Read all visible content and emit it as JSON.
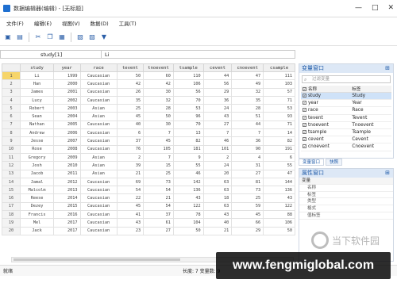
{
  "window": {
    "title": "数据编辑器(编辑) - [无标题]",
    "controls": [
      "—",
      "□",
      "✕"
    ]
  },
  "menu": [
    "文件(F)",
    "编辑(E)",
    "视图(V)",
    "数据(D)",
    "工具(T)"
  ],
  "formula": {
    "cell_ref": "study[1]",
    "value": "Li"
  },
  "grid": {
    "columns": [
      "study",
      "year",
      "race",
      "tevent",
      "tnoevent",
      "tsample",
      "cevent",
      "cnoevent",
      "csample"
    ],
    "rows": [
      [
        "1",
        "Li",
        "1999",
        "Caucasian",
        "50",
        "60",
        "110",
        "44",
        "47",
        "111"
      ],
      [
        "2",
        "Han",
        "2000",
        "Caucasian",
        "42",
        "42",
        "106",
        "56",
        "49",
        "103"
      ],
      [
        "3",
        "James",
        "2001",
        "Caucasian",
        "26",
        "30",
        "56",
        "29",
        "32",
        "57"
      ],
      [
        "4",
        "Lucy",
        "2002",
        "Caucasian",
        "35",
        "32",
        "70",
        "36",
        "35",
        "71"
      ],
      [
        "5",
        "Robert",
        "2003",
        "Asian",
        "25",
        "28",
        "53",
        "24",
        "28",
        "53"
      ],
      [
        "6",
        "Sean",
        "2004",
        "Asian",
        "45",
        "50",
        "96",
        "43",
        "51",
        "93"
      ],
      [
        "7",
        "Nathan",
        "2005",
        "Caucasian",
        "40",
        "30",
        "70",
        "27",
        "44",
        "71"
      ],
      [
        "8",
        "Andrew",
        "2006",
        "Caucasian",
        "6",
        "7",
        "13",
        "7",
        "7",
        "14"
      ],
      [
        "9",
        "Jesse",
        "2007",
        "Caucasian",
        "37",
        "45",
        "82",
        "46",
        "36",
        "82"
      ],
      [
        "10",
        "Rose",
        "2008",
        "Caucasian",
        "76",
        "105",
        "181",
        "101",
        "90",
        "191"
      ],
      [
        "11",
        "Gregory",
        "2009",
        "Asian",
        "2",
        "7",
        "9",
        "2",
        "4",
        "6"
      ],
      [
        "12",
        "Josh",
        "2010",
        "Asian",
        "39",
        "15",
        "55",
        "24",
        "31",
        "55"
      ],
      [
        "13",
        "Jacob",
        "2011",
        "Asian",
        "21",
        "25",
        "46",
        "20",
        "27",
        "47"
      ],
      [
        "14",
        "Jamal",
        "2012",
        "Caucasian",
        "69",
        "73",
        "142",
        "63",
        "81",
        "144"
      ],
      [
        "15",
        "Malcolm",
        "2013",
        "Caucasian",
        "54",
        "54",
        "136",
        "63",
        "73",
        "136"
      ],
      [
        "16",
        "Reese",
        "2014",
        "Caucasian",
        "22",
        "21",
        "43",
        "18",
        "25",
        "43"
      ],
      [
        "17",
        "Dezey",
        "2015",
        "Caucasian",
        "45",
        "54",
        "122",
        "63",
        "59",
        "122"
      ],
      [
        "18",
        "Francis",
        "2016",
        "Caucasian",
        "41",
        "37",
        "78",
        "43",
        "45",
        "88"
      ],
      [
        "19",
        "Mel",
        "2017",
        "Caucasian",
        "43",
        "61",
        "104",
        "40",
        "66",
        "106"
      ],
      [
        "20",
        "Jack",
        "2017",
        "Caucasian",
        "23",
        "27",
        "50",
        "21",
        "29",
        "50"
      ]
    ]
  },
  "variable_panel": {
    "title": "变量窗口",
    "filter_placeholder": "过滤变量",
    "headers": [
      "名称",
      "标签"
    ],
    "vars": [
      [
        "study",
        "Study"
      ],
      [
        "year",
        "Year"
      ],
      [
        "race",
        "Race"
      ],
      [
        "tevent",
        "Tevent"
      ],
      [
        "tnoevent",
        "Tnoevent"
      ],
      [
        "tsample",
        "Tsample"
      ],
      [
        "cevent",
        "Cevent"
      ],
      [
        "cnoevent",
        "Cnoevent"
      ]
    ],
    "tabs": [
      "变量窗口",
      "快照"
    ]
  },
  "property_panel": {
    "title": "属性窗口",
    "section": "变量",
    "rows": [
      "名称",
      "标签",
      "类型",
      "格式",
      "值标签"
    ]
  },
  "status": {
    "left": "就绪",
    "right": "长度: 7    变量数: 9"
  },
  "watermark": {
    "text": "www.fengmiglobal.com"
  },
  "logo": {
    "text": "当下软件园"
  }
}
